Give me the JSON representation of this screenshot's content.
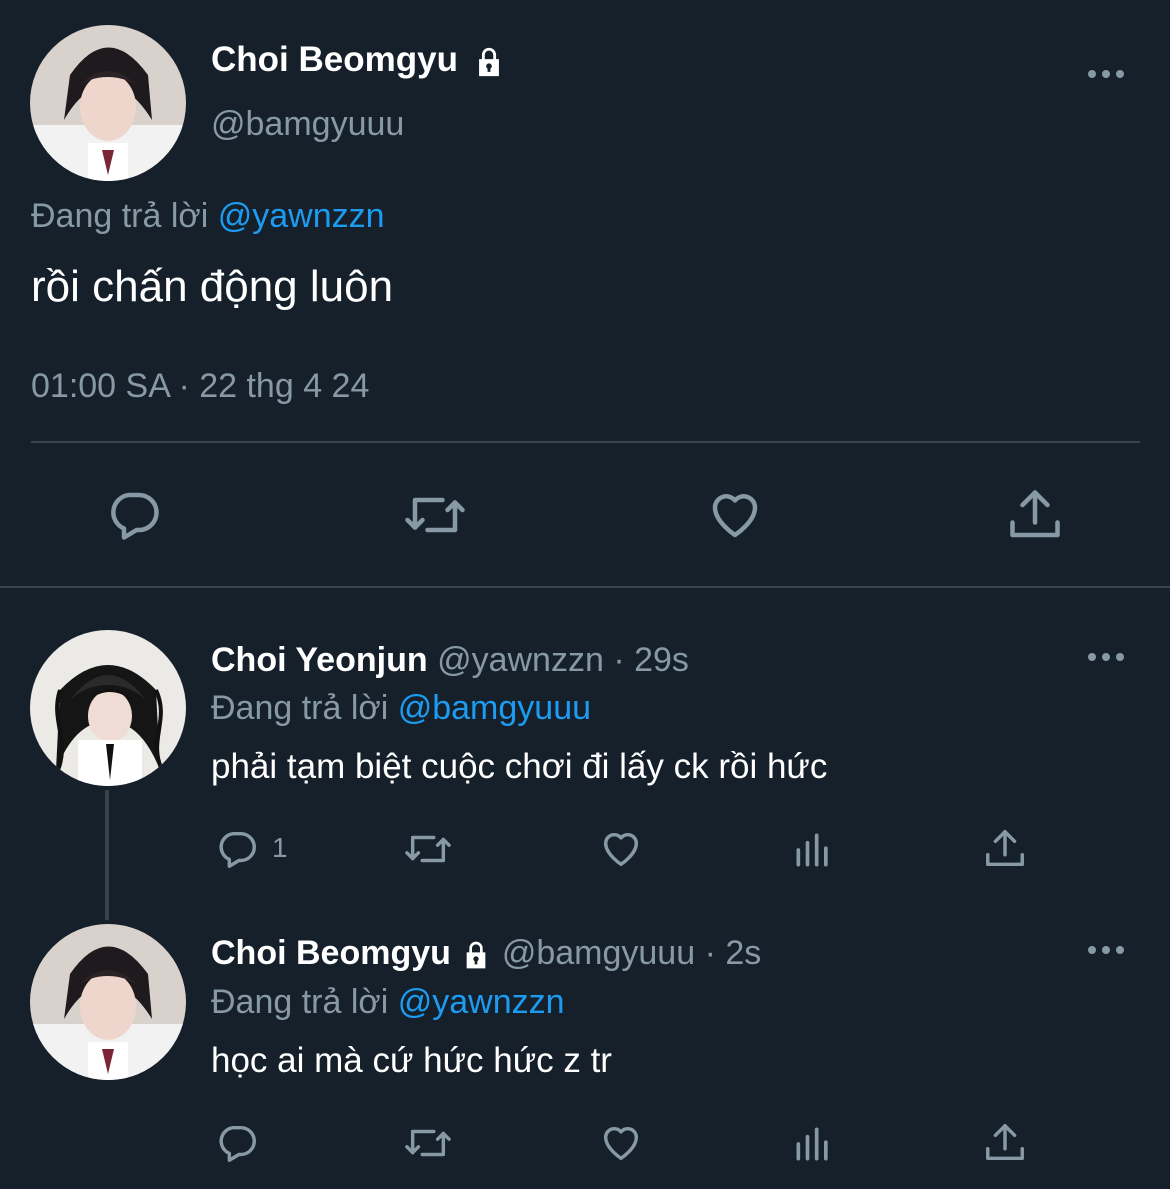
{
  "main_tweet": {
    "author_name": "Choi Beomgyu",
    "handle": "@bamgyuuu",
    "replying_prefix": "Đang trả lời",
    "replying_to": "@yawnzzn",
    "text": "rồi chấn động luôn",
    "timestamp": "01:00 SA · 22 thg 4 24"
  },
  "replies": [
    {
      "author_name": "Choi Yeonjun",
      "handle": "@yawnzzn",
      "time": "· 29s",
      "replying_prefix": "Đang trả lời",
      "replying_to": "@bamgyuuu",
      "text": "phải tạm biệt cuộc chơi đi lấy ck rồi hức",
      "reply_count": "1"
    },
    {
      "author_name": "Choi Beomgyu",
      "handle": "@bamgyuuu",
      "time": "· 2s",
      "replying_prefix": "Đang trả lời",
      "replying_to": "@yawnzzn",
      "text": "học ai mà cứ hức hức z tr"
    }
  ],
  "icons": {
    "reply": "reply-icon",
    "retweet": "retweet-icon",
    "like": "like-icon",
    "views": "views-icon",
    "share": "share-icon",
    "more": "more-icon",
    "lock": "lock-icon"
  },
  "colors": {
    "background": "#15202b",
    "text": "#ffffff",
    "muted": "#8899a6",
    "link": "#1d9bf0",
    "divider": "#38444d"
  }
}
